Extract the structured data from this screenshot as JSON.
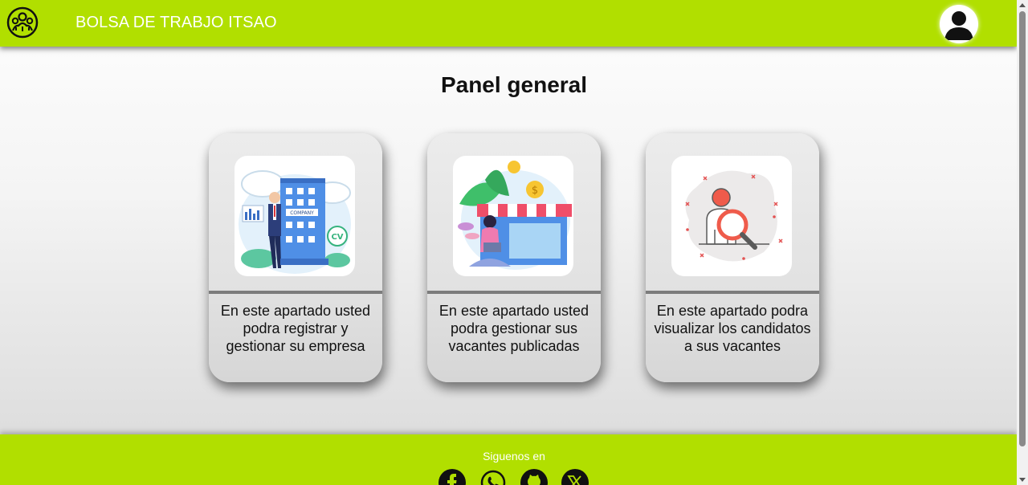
{
  "header": {
    "brand": "BOLSA DE TRABJO ITSAO",
    "logo_icon": "community-logo-icon",
    "profile_icon": "user-avatar-icon"
  },
  "main": {
    "title": "Panel general",
    "cards": [
      {
        "icon": "company-building-icon",
        "text": "En este apartado usted podra registrar y gestionar su empresa"
      },
      {
        "icon": "storefront-vacancies-icon",
        "text": "En este apartado usted podra gestionar sus vacantes publicadas"
      },
      {
        "icon": "candidate-search-icon",
        "text": "En este apartado podra visualizar los candidatos a sus vacantes"
      }
    ]
  },
  "footer": {
    "follow_label": "Siguenos en",
    "social": [
      "facebook-icon",
      "whatsapp-icon",
      "github-icon",
      "x-icon"
    ]
  },
  "colors": {
    "accent": "#b1df00",
    "text": "#111111",
    "card_bg": "#e2e2e2",
    "divider": "#7c7c7c"
  }
}
